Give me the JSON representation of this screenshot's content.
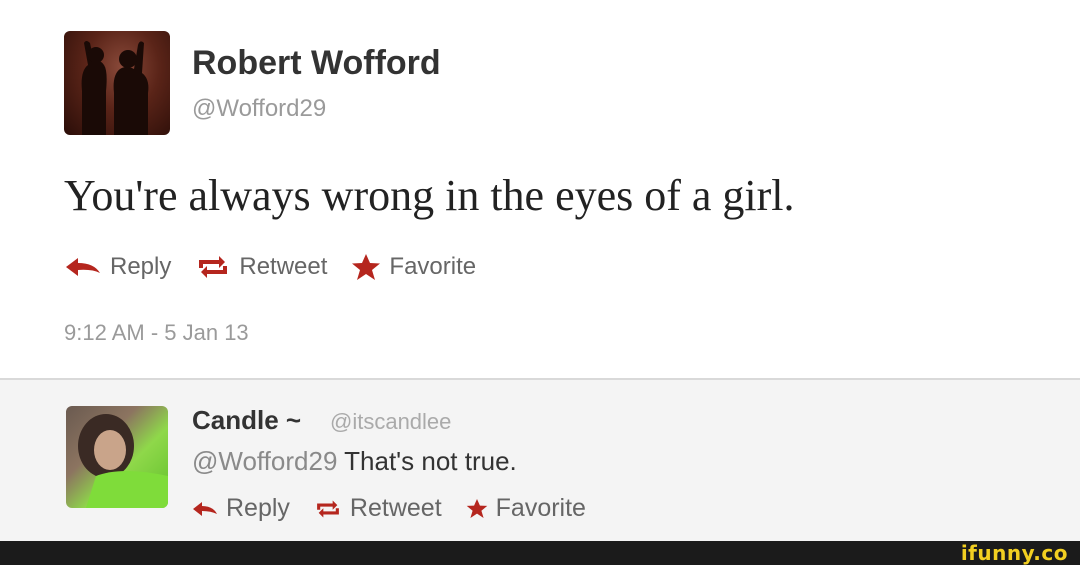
{
  "main_tweet": {
    "author_name": "Robert Wofford",
    "author_handle": "@Wofford29",
    "text": "You're always wrong in the eyes of a girl.",
    "actions": {
      "reply": "Reply",
      "retweet": "Retweet",
      "favorite": "Favorite"
    },
    "timestamp": "9:12 AM - 5 Jan 13"
  },
  "reply_tweet": {
    "author_name": "Candle ~",
    "author_handle": "@itscandlee",
    "mention": "@Wofford29",
    "text": " That's not true.",
    "actions": {
      "reply": "Reply",
      "retweet": "Retweet",
      "favorite": "Favorite"
    }
  },
  "watermark": "ifunny.co",
  "colors": {
    "action_icon": "#b5261e",
    "handle_gray": "#9a9a9a",
    "watermark": "#f2cf21"
  },
  "icons": {
    "reply": "reply-arrow-icon",
    "retweet": "retweet-icon",
    "favorite": "star-icon"
  }
}
